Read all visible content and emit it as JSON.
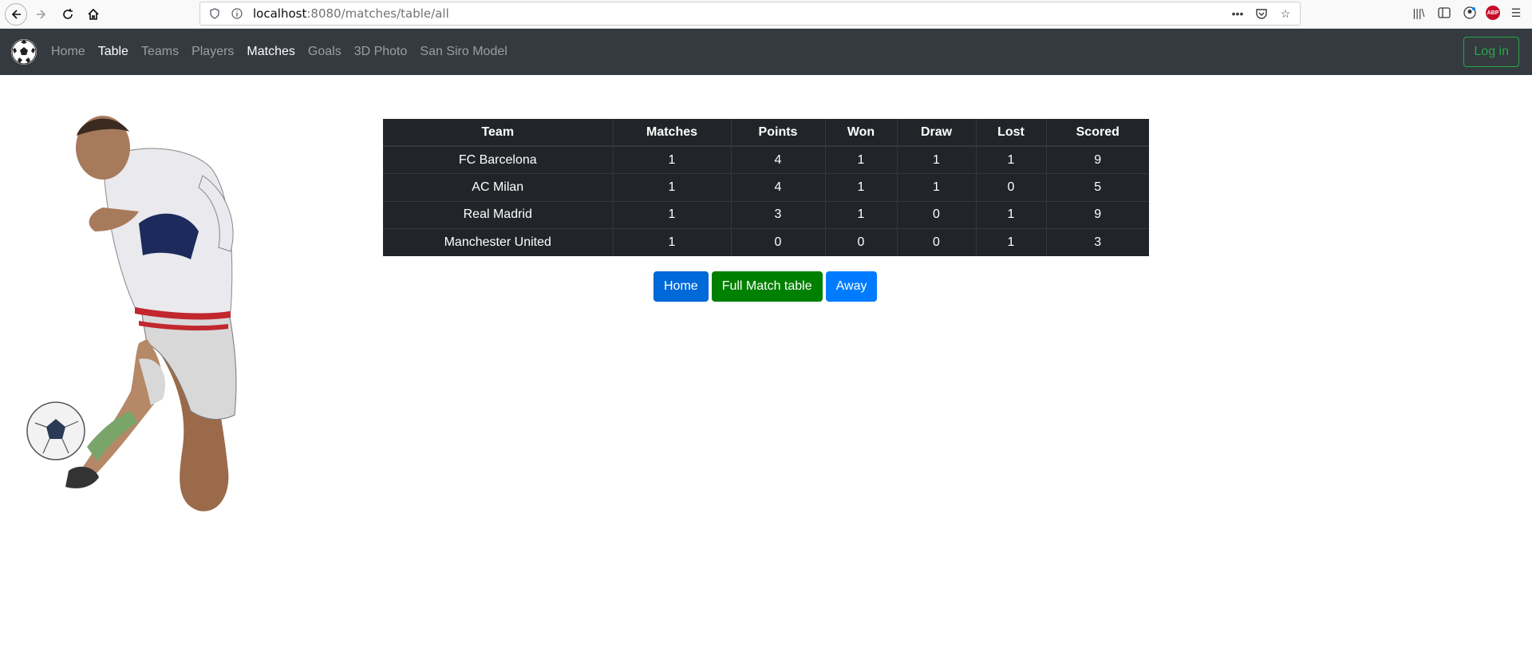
{
  "browser": {
    "url_host": "localhost",
    "url_path": ":8080/matches/table/all"
  },
  "navbar": {
    "links": [
      "Home",
      "Table",
      "Teams",
      "Players",
      "Matches",
      "Goals",
      "3D Photo",
      "San Siro Model"
    ],
    "active": [
      "Table",
      "Matches"
    ],
    "login_label": "Log in"
  },
  "table": {
    "headers": [
      "Team",
      "Matches",
      "Points",
      "Won",
      "Draw",
      "Lost",
      "Scored"
    ],
    "rows": [
      [
        "FC Barcelona",
        "1",
        "4",
        "1",
        "1",
        "1",
        "9"
      ],
      [
        "AC Milan",
        "1",
        "4",
        "1",
        "1",
        "0",
        "5"
      ],
      [
        "Real Madrid",
        "1",
        "3",
        "1",
        "0",
        "1",
        "9"
      ],
      [
        "Manchester United",
        "1",
        "0",
        "0",
        "0",
        "1",
        "3"
      ]
    ]
  },
  "buttons": {
    "home": "Home",
    "full": "Full Match table",
    "away": "Away"
  },
  "icons": {
    "brand": "soccer-ball-icon",
    "player": "football-player-image"
  }
}
